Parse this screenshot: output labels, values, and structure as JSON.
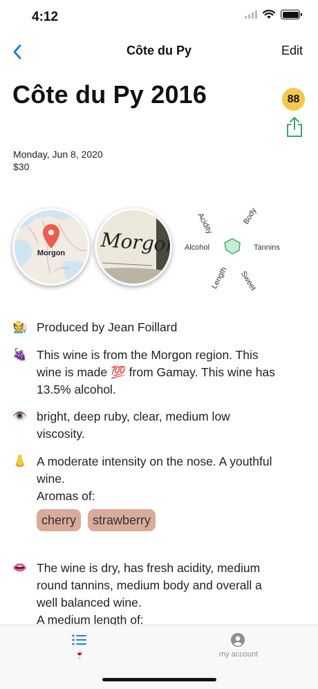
{
  "status": {
    "time": "4:12"
  },
  "nav": {
    "title": "Côte du Py",
    "edit_label": "Edit"
  },
  "wine": {
    "title": "Côte du Py 2016",
    "score": "88",
    "date": "Monday, Jun 8, 2020",
    "price": "$30",
    "map_label": "Morgon",
    "label_text": "Morgon"
  },
  "radar": {
    "labels": {
      "acidity": "Acidity",
      "body": "Body",
      "alcohol": "Alcohol",
      "tannins": "Tannins",
      "length": "Length",
      "sweet": "Sweet"
    }
  },
  "details": {
    "producer": {
      "icon": "🧑‍🌾",
      "text": "Produced by Jean Foillard"
    },
    "region": {
      "icon": "🍇",
      "line1": "This wine is from the Morgon region. This",
      "line2": "wine is made 💯 from Gamay. This wine has",
      "line3": "13.5% alcohol."
    },
    "appearance": {
      "icon": "👁️",
      "line1": "bright, deep ruby, clear, medium low",
      "line2": "viscosity."
    },
    "nose": {
      "icon": "👃",
      "line1": "A moderate intensity on the nose. A youthful",
      "line2": "wine.",
      "aromas_label": "Aromas of:",
      "aromas": [
        "cherry",
        "strawberry"
      ]
    },
    "palate": {
      "icon": "👄",
      "line1": "The wine is dry, has fresh acidity, medium",
      "line2": "round tannins, medium body and overall a",
      "line3": "well balanced wine.",
      "line4": "A medium length of:"
    }
  },
  "tabs": {
    "wines_icon": "🍷",
    "account_label": "my account"
  },
  "colors": {
    "accent": "#1a7ee6",
    "score": "#f5c84a",
    "share": "#3aa56b",
    "chip": "#d9ab9b",
    "radar": "#3aa56b"
  }
}
